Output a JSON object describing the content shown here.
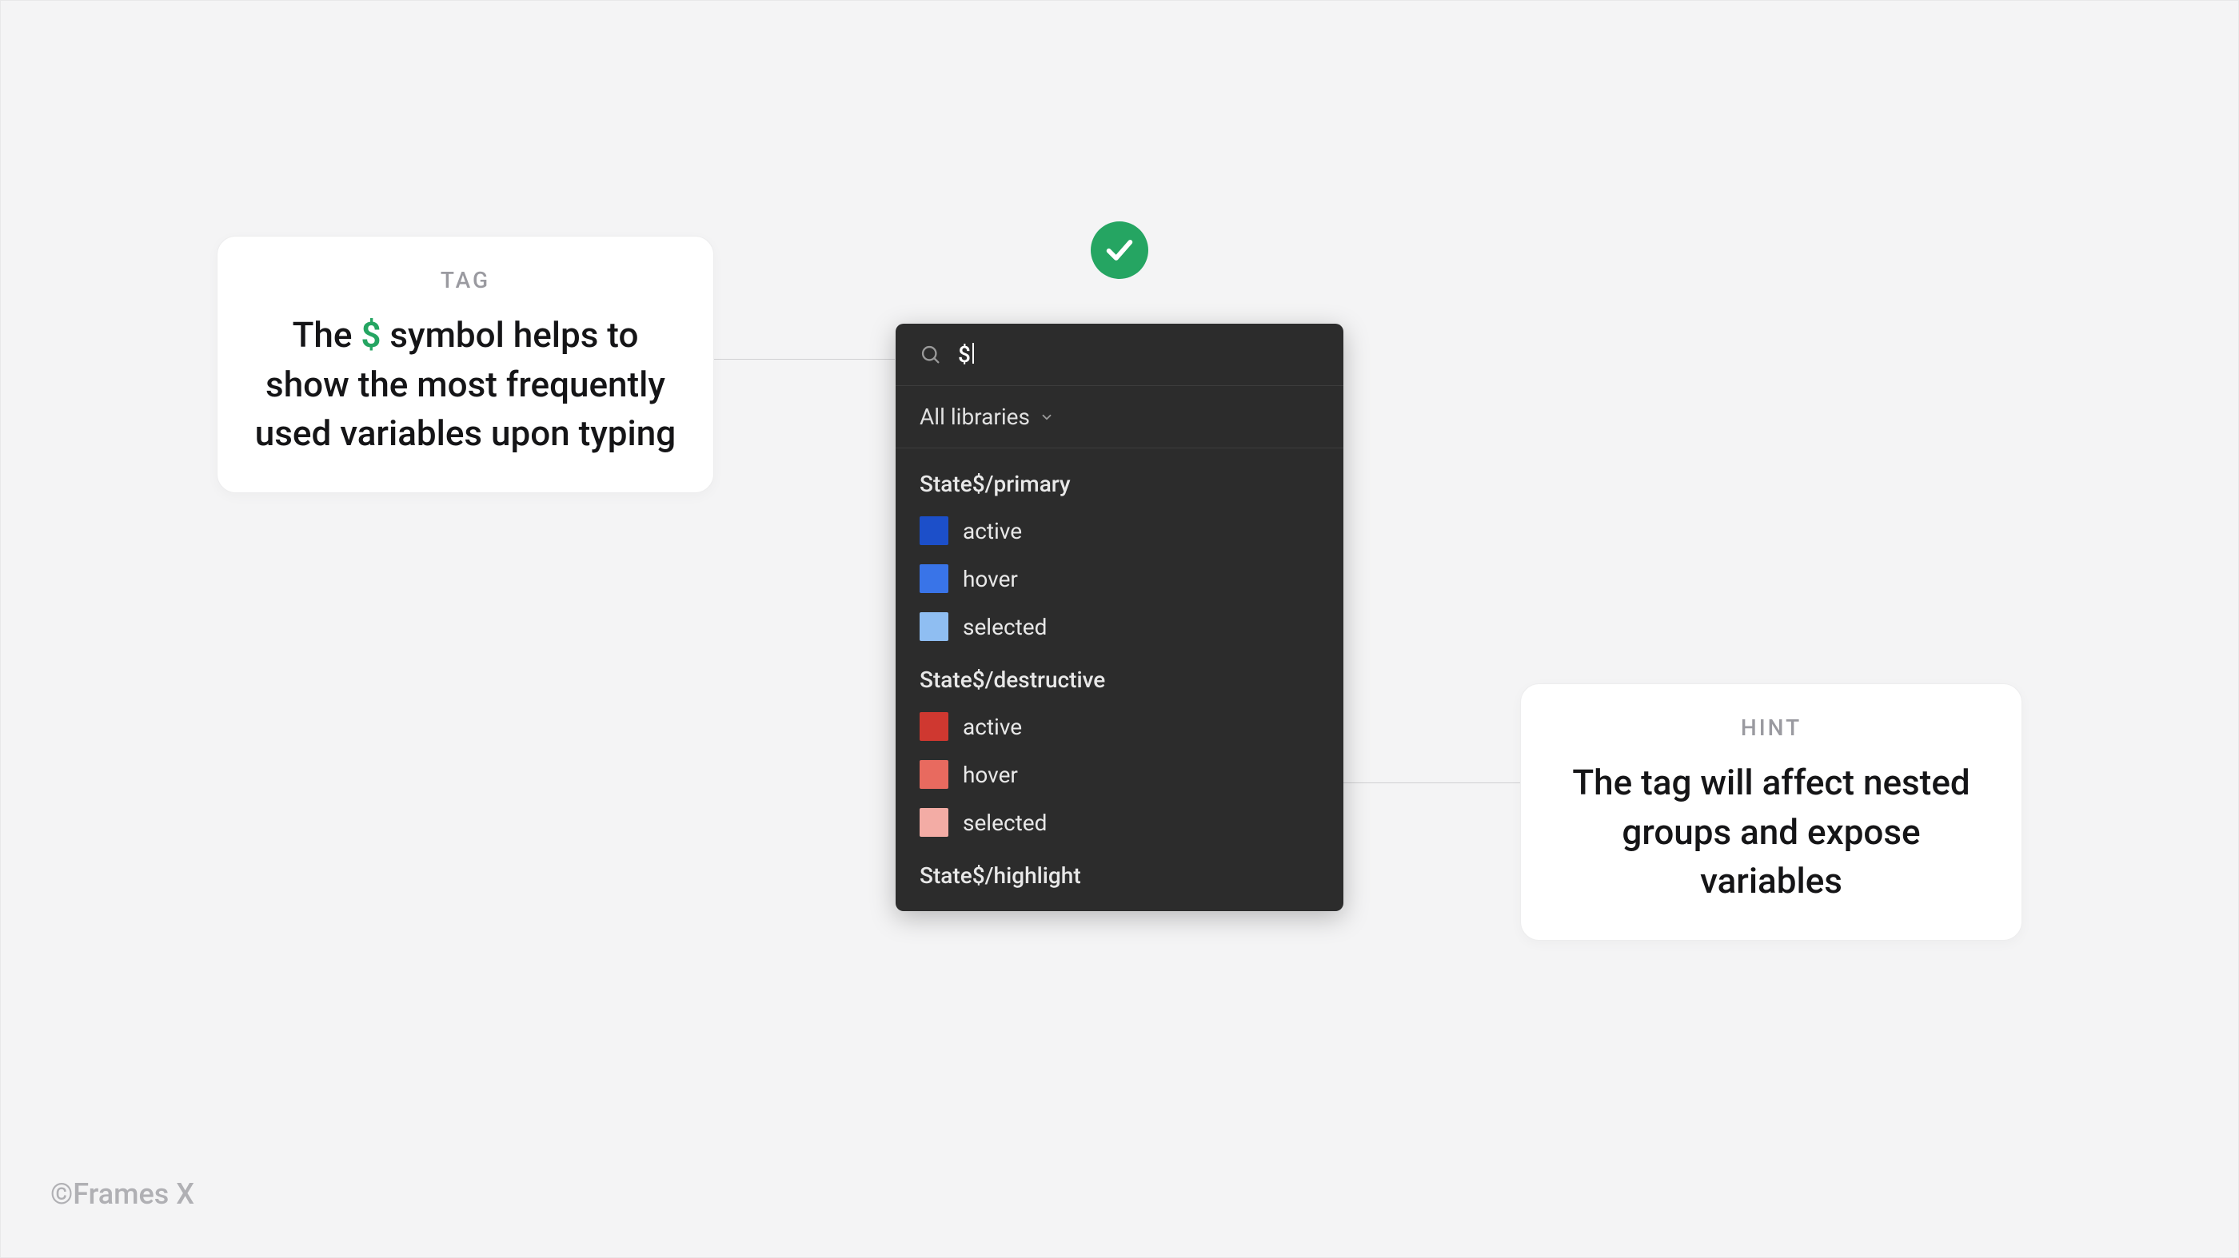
{
  "callout_left": {
    "label": "TAG",
    "text_before": "The ",
    "symbol": "$",
    "text_after": " symbol helps to show the most frequently used variables upon typing"
  },
  "callout_right": {
    "label": "HINT",
    "text": "The tag will affect nested groups and expose variables"
  },
  "picker": {
    "search_value": "$",
    "filter_label": "All libraries",
    "groups": [
      {
        "name": "State$/primary",
        "items": [
          {
            "label": "active",
            "color": "#1c4fc9"
          },
          {
            "label": "hover",
            "color": "#3974e8"
          },
          {
            "label": "selected",
            "color": "#8fbef2"
          }
        ]
      },
      {
        "name": "State$/destructive",
        "items": [
          {
            "label": "active",
            "color": "#cf3830"
          },
          {
            "label": "hover",
            "color": "#e86a5f"
          },
          {
            "label": "selected",
            "color": "#f3aca5"
          }
        ]
      },
      {
        "name": "State$/highlight",
        "items": []
      }
    ]
  },
  "watermark": "©Frames X"
}
